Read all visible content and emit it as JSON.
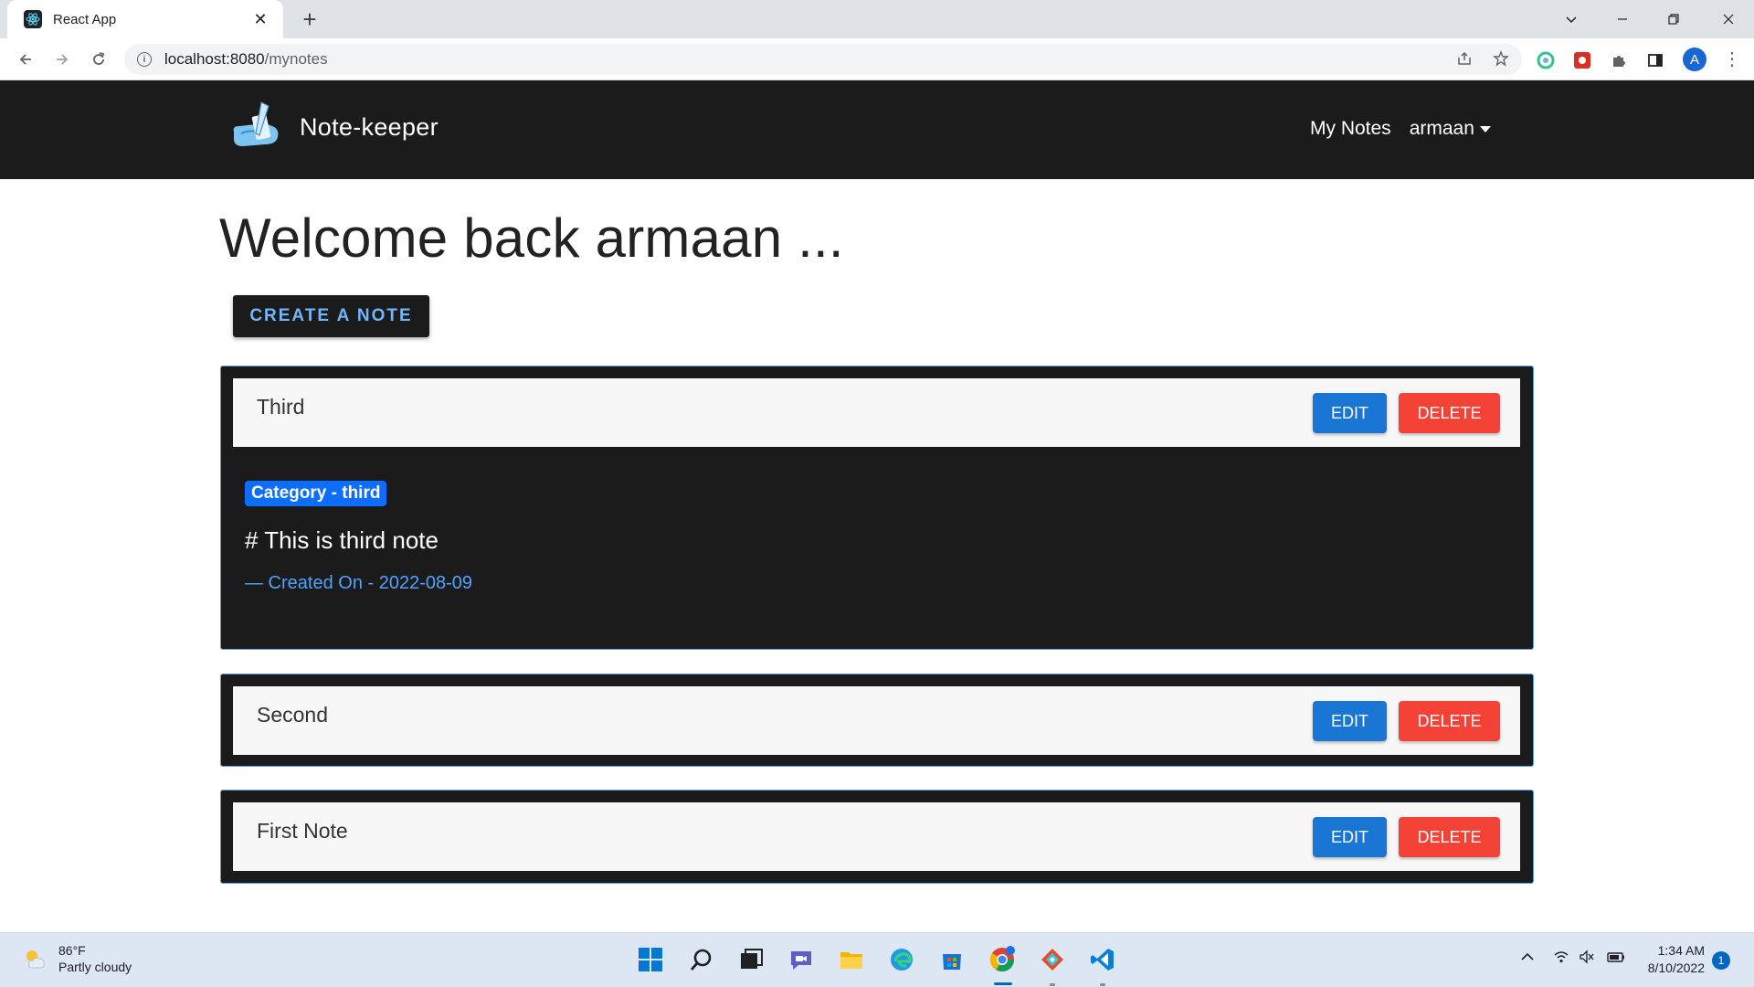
{
  "browser": {
    "tab_title": "React App",
    "tab_close": "✕",
    "new_tab": "+",
    "url_host": "localhost:8080",
    "url_path": "/mynotes",
    "profile_initial": "A",
    "window_controls": [
      "chevron-down",
      "minimize",
      "restore",
      "close"
    ]
  },
  "navbar": {
    "brand": "Note-keeper",
    "links": {
      "my_notes": "My Notes",
      "user": "armaan"
    }
  },
  "main": {
    "welcome": "Welcome back armaan ...",
    "create_button": "CREATE A NOTE"
  },
  "notes": [
    {
      "title": "Third",
      "edit": "EDIT",
      "delete": "DELETE",
      "category": "Category - third",
      "content": "# This is third note",
      "created": "— Created On - 2022-08-09"
    },
    {
      "title": "Second",
      "edit": "EDIT",
      "delete": "DELETE"
    },
    {
      "title": "First Note",
      "edit": "EDIT",
      "delete": "DELETE"
    }
  ],
  "taskbar": {
    "weather_temp": "86°F",
    "weather_desc": "Partly cloudy",
    "time": "1:34 AM",
    "date": "8/10/2022",
    "notification_count": "1"
  },
  "colors": {
    "navbar_bg": "#1b1b1b",
    "edit_button": "#1976d2",
    "delete_button": "#f44336",
    "badge": "#0d6efd",
    "accent_text": "#4fa3ff",
    "card_border": "#5aa0e8"
  }
}
